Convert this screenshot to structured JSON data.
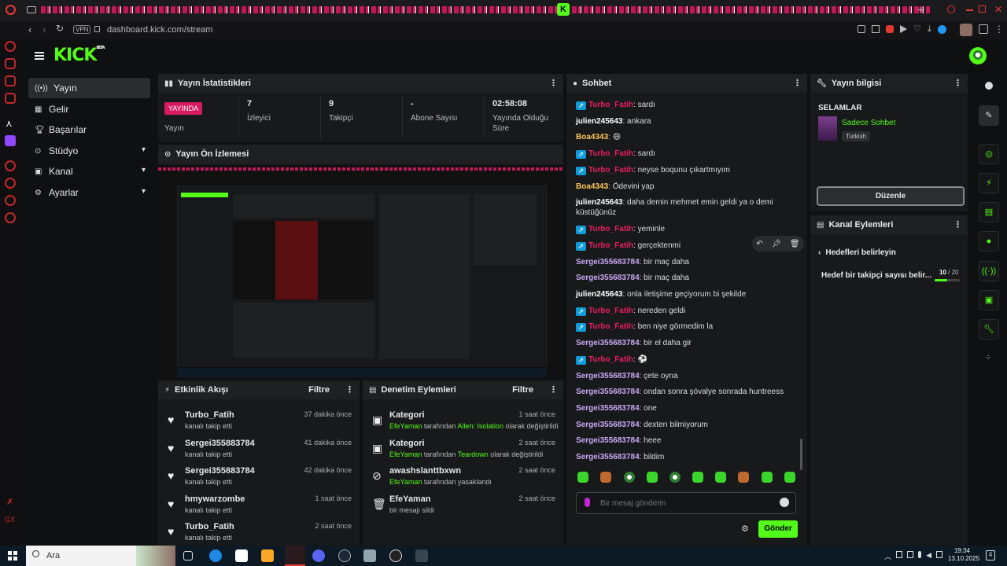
{
  "browser": {
    "url": "dashboard.kick.com/stream",
    "vpn_label": "VPN"
  },
  "brand": {
    "logo": "KICK",
    "beta": "BETA",
    "accent": "#53fc18"
  },
  "nav": [
    {
      "label": "Yayın"
    },
    {
      "label": "Gelir"
    },
    {
      "label": "Başarılar"
    },
    {
      "label": "Stüdyo"
    },
    {
      "label": "Kanal"
    },
    {
      "label": "Ayarlar"
    }
  ],
  "stats_panel": {
    "title": "Yayın İstatistikleri",
    "live_badge": "YAYINDA",
    "live_label": "Yayın",
    "items": [
      {
        "value": "7",
        "label": "İzleyici"
      },
      {
        "value": "9",
        "label": "Takipçi"
      },
      {
        "value": "-",
        "label": "Abone Sayısı"
      },
      {
        "value": "02:58:08",
        "label": "Yayında Olduğu Süre"
      }
    ]
  },
  "preview_panel": {
    "title": "Yayın Ön İzlemesi"
  },
  "activity_panel": {
    "title": "Etkinlik Akışı",
    "filter": "Filtre",
    "events": [
      {
        "name": "Turbo_Fatih",
        "sub": "kanalı takip etti",
        "time": "37 dakika önce"
      },
      {
        "name": "Sergei355883784",
        "sub": "kanalı takip etti",
        "time": "41 dakika önce"
      },
      {
        "name": "Sergei355883784",
        "sub": "kanalı takip etti",
        "time": "42 dakika önce"
      },
      {
        "name": "hmywarzombe",
        "sub": "kanalı takip etti",
        "time": "1 saat önce"
      },
      {
        "name": "Turbo_Fatih",
        "sub": "kanalı takip etti",
        "time": "2 saat önce"
      }
    ]
  },
  "moderation_panel": {
    "title": "Denetim Eylemleri",
    "filter": "Filtre",
    "events": [
      {
        "name": "Kategori",
        "actor": "EfeYaman",
        "mid": " tarafından ",
        "target": "Allen: Isolation",
        "rest": " olarak değiştirildi",
        "time": "1 saat önce"
      },
      {
        "name": "Kategori",
        "actor": "EfeYaman",
        "mid": " tarafından ",
        "target": "Teardown",
        "rest": " olarak değiştirildi",
        "time": "2 saat önce"
      },
      {
        "name": "awashslanttbxwn",
        "actor": "EfeYaman",
        "mid": " tarafından yasaklandı",
        "target": "",
        "rest": "",
        "time": "2 saat önce"
      },
      {
        "name": "EfeYaman",
        "actor": "",
        "mid": "bir mesajı sildi",
        "target": "",
        "rest": "",
        "time": "2 saat önce"
      }
    ]
  },
  "chat_panel": {
    "title": "Sohbet",
    "placeholder": "Bir mesaj gönderin",
    "send": "Gönder",
    "messages": [
      {
        "user": "Turbo_Fatih",
        "text": ": sardı",
        "color": "#e91e63",
        "badge": true
      },
      {
        "user": "julien245643",
        "text": ": ankara",
        "color": "#ffffff",
        "badge": false
      },
      {
        "user": "Boa4343",
        "text": ": 😄",
        "color": "#ffc857",
        "badge": false
      },
      {
        "user": "Turbo_Fatih",
        "text": ": sardı",
        "color": "#e91e63",
        "badge": true
      },
      {
        "user": "Turbo_Fatih",
        "text": ": neyse boqunu çıkartmıyım",
        "color": "#e91e63",
        "badge": true
      },
      {
        "user": "Boa4343",
        "text": ": Ödevini yap",
        "color": "#ffc857",
        "badge": false
      },
      {
        "user": "julien245643",
        "text": ": daha demin mehmet emin geldi ya o demi",
        "color": "#ffffff",
        "badge": false,
        "cont": "küstüğünüz"
      },
      {
        "user": "Turbo_Fatih",
        "text": ": yeminle",
        "color": "#e91e63",
        "badge": true
      },
      {
        "user": "Turbo_Fatih",
        "text": ": gerçektenmi",
        "color": "#e91e63",
        "badge": true
      },
      {
        "user": "Sergei355683784",
        "text": ": bir maç daha",
        "color": "#c9a9f7",
        "badge": false
      },
      {
        "user": "Sergei355683784",
        "text": ": bir maç daha",
        "color": "#c9a9f7",
        "badge": false
      },
      {
        "user": "julien245643",
        "text": ": onla iletişime geçiyorum bi şekilde",
        "color": "#ffffff",
        "badge": false
      },
      {
        "user": "Turbo_Fatih",
        "text": ": nereden geldi",
        "color": "#e91e63",
        "badge": true
      },
      {
        "user": "Turbo_Fatih",
        "text": ": ben niye görmedim la",
        "color": "#e91e63",
        "badge": true
      },
      {
        "user": "Sergei355683784",
        "text": ": bir el daha gir",
        "color": "#c9a9f7",
        "badge": false
      },
      {
        "user": "Turbo_Fatih",
        "text": ": ⚽",
        "color": "#e91e63",
        "badge": true
      },
      {
        "user": "Sergei355683784",
        "text": ": çete oyna",
        "color": "#c9a9f7",
        "badge": false
      },
      {
        "user": "Sergei355683784",
        "text": ": ondan sonra şövalye sonrada huntreess",
        "color": "#c9a9f7",
        "badge": false
      },
      {
        "user": "Sergei355683784",
        "text": ": one",
        "color": "#c9a9f7",
        "badge": false
      },
      {
        "user": "Sergei355683784",
        "text": ": dexterı bilmiyorum",
        "color": "#c9a9f7",
        "badge": false
      },
      {
        "user": "Sergei355683784",
        "text": ": heee",
        "color": "#c9a9f7",
        "badge": false
      },
      {
        "user": "Sergei355683784",
        "text": ": bildim",
        "color": "#c9a9f7",
        "badge": false
      }
    ]
  },
  "info_panel": {
    "title": "Yayın bilgisi",
    "stream_title": "SELAMLAR",
    "category": "Sadece Sohbet",
    "language": "Turkish",
    "edit": "Düzenle"
  },
  "channel_actions": {
    "title": "Kanal Eylemleri",
    "sub_title": "Hedefleri belirleyin",
    "goal_label": "Hedef bir takipçi sayısı belir...",
    "goal_current": "10",
    "goal_sep": " / ",
    "goal_total": "20",
    "goal_progress": 0.5
  },
  "taskbar": {
    "search": "Ara",
    "time": "19:34",
    "date": "13.10.2025"
  }
}
